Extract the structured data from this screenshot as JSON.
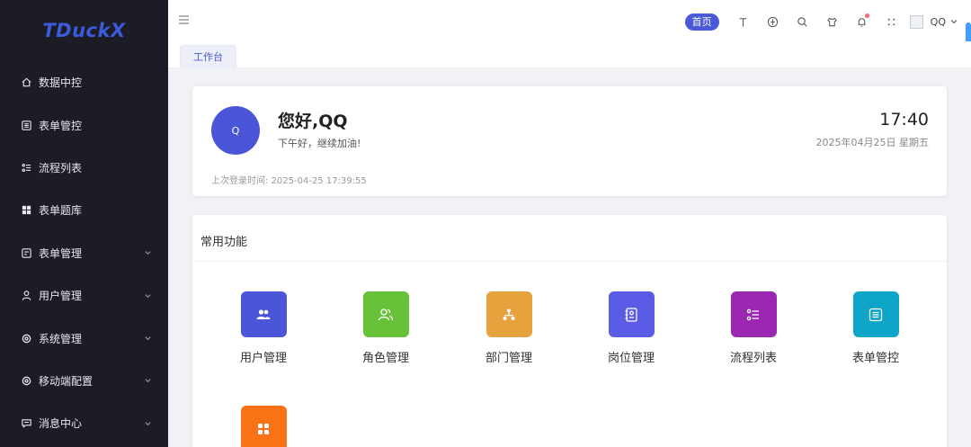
{
  "app": {
    "logo": "TDuckX"
  },
  "sidebar": {
    "items": [
      {
        "label": "数据中控",
        "icon": "home-icon",
        "expandable": false
      },
      {
        "label": "表单管控",
        "icon": "form-list-icon",
        "expandable": false
      },
      {
        "label": "流程列表",
        "icon": "flow-list-icon",
        "expandable": false
      },
      {
        "label": "表单题库",
        "icon": "grid-icon",
        "expandable": false
      },
      {
        "label": "表单管理",
        "icon": "form-edit-icon",
        "expandable": true
      },
      {
        "label": "用户管理",
        "icon": "user-icon",
        "expandable": true
      },
      {
        "label": "系统管理",
        "icon": "gear-icon",
        "expandable": true
      },
      {
        "label": "移动端配置",
        "icon": "gear-icon",
        "expandable": true
      },
      {
        "label": "消息中心",
        "icon": "message-icon",
        "expandable": true
      }
    ]
  },
  "header": {
    "home_label": "首页",
    "user_name": "QQ",
    "icons": [
      "font-size-icon",
      "language-icon",
      "search-icon",
      "theme-icon",
      "bell-icon",
      "fullscreen-icon",
      "user-avatar-icon"
    ],
    "accent": "#4a5ad6"
  },
  "tabs": [
    {
      "label": "工作台"
    }
  ],
  "welcome": {
    "avatar_text": "Q",
    "greeting": "您好,QQ",
    "subtitle": "下午好，继续加油!",
    "time": "17:40",
    "date": "2025年04月25日 星期五",
    "last_login": "上次登录时间: 2025-04-25 17:39:55"
  },
  "functions": {
    "title": "常用功能",
    "items": [
      {
        "label": "用户管理",
        "color": "#4a55d8",
        "icon": "users-icon"
      },
      {
        "label": "角色管理",
        "color": "#67c23a",
        "icon": "role-icon"
      },
      {
        "label": "部门管理",
        "color": "#e6a23c",
        "icon": "department-icon"
      },
      {
        "label": "岗位管理",
        "color": "#5b5ce6",
        "icon": "post-icon"
      },
      {
        "label": "流程列表",
        "color": "#9c27b0",
        "icon": "flow-list-icon"
      },
      {
        "label": "表单管控",
        "color": "#0ea5c8",
        "icon": "form-list-icon"
      },
      {
        "label": "",
        "color": "#f97316",
        "icon": "grid-icon"
      }
    ]
  }
}
